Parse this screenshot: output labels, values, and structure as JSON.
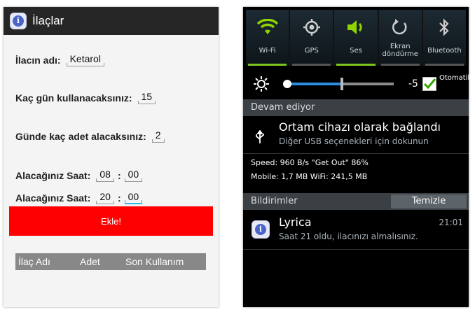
{
  "left": {
    "app_title": "İlaçlar",
    "drug_name_label": "İlacın adı:",
    "drug_name_value": "Ketarol",
    "days_label": "Kaç gün kullanacaksınız:",
    "days_value": "15",
    "daily_label": "Günde kaç adet alacaksınız:",
    "daily_value": "2",
    "time_label": "Alacağınız Saat:",
    "times": [
      {
        "hour": "08",
        "sep": ":",
        "minute": "00"
      },
      {
        "hour": "20",
        "sep": ":",
        "minute": "00"
      }
    ],
    "add_button": "Ekle!",
    "table_headers": [
      "İlaç Adı",
      "Adet",
      "Son Kullanım"
    ],
    "accent_color": "#ff0000"
  },
  "right": {
    "quick_settings": [
      {
        "label": "Wi-Fi",
        "icon": "wifi-icon",
        "on": true
      },
      {
        "label": "GPS",
        "icon": "gps-icon",
        "on": false
      },
      {
        "label": "Ses",
        "icon": "sound-icon",
        "on": true
      },
      {
        "label": "Ekran döndürme",
        "icon": "rotate-icon",
        "on": false
      },
      {
        "label": "Bluetooth",
        "icon": "bluetooth-icon",
        "on": false
      }
    ],
    "brightness_value": "-5",
    "brightness_level": 0.5,
    "auto_label": "Otomatik",
    "ongoing_header": "Devam ediyor",
    "usb_title": "Ortam cihazı olarak bağlandı",
    "usb_subtitle": "Diğer USB seçenekleri için dokunun",
    "speed_line": "Speed: 960 B/s   \"Get Out\" 86%",
    "data_line": "Mobile: 1,7 MB   WiFi: 241,5 MB",
    "notifications_header": "Bildirimler",
    "clear_button": "Temizle",
    "notif_title": "Lyrica",
    "notif_time": "21:01",
    "notif_text": "Saat 21 oldu, ilacınızı almalısınız.",
    "on_color": "#7fc41f"
  }
}
